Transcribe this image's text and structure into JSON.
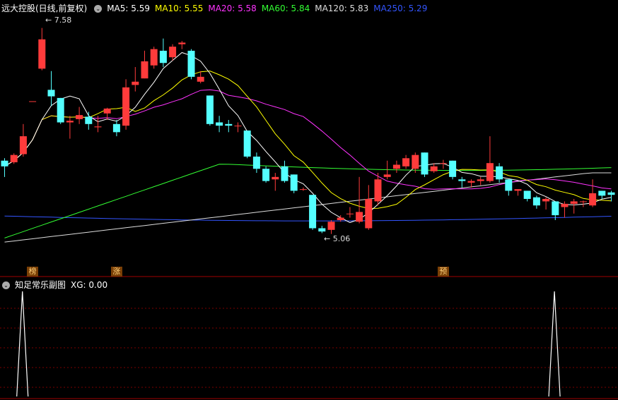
{
  "main_header": {
    "title": "远大控股(日线,前复权)",
    "ma": [
      {
        "label": "MA5: 5.59",
        "color": "#ffffff"
      },
      {
        "label": "MA10: 5.55",
        "color": "#ffff00"
      },
      {
        "label": "MA20: 5.58",
        "color": "#ff33ff"
      },
      {
        "label": "MA60: 5.84",
        "color": "#33ff33"
      },
      {
        "label": "MA120: 5.83",
        "color": "#dddddd"
      },
      {
        "label": "MA250: 5.29",
        "color": "#3355ff"
      }
    ]
  },
  "sub_header": {
    "title": "知足常乐副图",
    "xg_label": "XG: 0.00"
  },
  "annotations": {
    "high": "7.58",
    "low": "5.06"
  },
  "tags": [
    "榜",
    "涨",
    "预"
  ],
  "colors": {
    "up": "#ff3b3b",
    "down": "#54ffff",
    "grid": "#7a0000",
    "border": "#a00000"
  },
  "chart_data": {
    "type": "candlestick",
    "ylim": [
      4.7,
      7.75
    ],
    "candles": [
      [
        5.95,
        5.88,
        5.98,
        5.75
      ],
      [
        5.93,
        6.02,
        6.04,
        5.91
      ],
      [
        6.03,
        6.25,
        6.4,
        6.0
      ],
      [
        6.68,
        6.68,
        6.68,
        6.68
      ],
      [
        7.08,
        7.44,
        7.58,
        7.06
      ],
      [
        6.82,
        6.74,
        7.05,
        6.62
      ],
      [
        6.72,
        6.42,
        6.72,
        6.4
      ],
      [
        6.42,
        6.44,
        6.5,
        6.22
      ],
      [
        6.46,
        6.51,
        6.61,
        6.4
      ],
      [
        6.49,
        6.4,
        6.55,
        6.33
      ],
      [
        6.36,
        6.37,
        6.5,
        6.3
      ],
      [
        6.53,
        6.59,
        6.6,
        6.45
      ],
      [
        6.4,
        6.3,
        6.45,
        6.25
      ],
      [
        6.38,
        6.85,
        6.95,
        6.33
      ],
      [
        6.88,
        6.92,
        7.1,
        6.8
      ],
      [
        6.96,
        7.17,
        7.3,
        6.96
      ],
      [
        7.12,
        7.32,
        7.35,
        7.08
      ],
      [
        7.3,
        7.15,
        7.45,
        7.1
      ],
      [
        7.22,
        7.35,
        7.38,
        7.18
      ],
      [
        7.38,
        7.4,
        7.42,
        7.32
      ],
      [
        7.3,
        6.98,
        7.32,
        6.95
      ],
      [
        6.92,
        6.98,
        7.05,
        6.9
      ],
      [
        6.75,
        6.4,
        6.75,
        6.38
      ],
      [
        6.42,
        6.38,
        6.5,
        6.3
      ],
      [
        6.4,
        6.38,
        6.45,
        6.3
      ],
      [
        6.38,
        6.38,
        6.42,
        6.3
      ],
      [
        6.32,
        6.0,
        6.32,
        5.98
      ],
      [
        6.0,
        5.85,
        6.05,
        5.8
      ],
      [
        5.85,
        5.7,
        5.88,
        5.68
      ],
      [
        5.72,
        5.75,
        5.8,
        5.58
      ],
      [
        5.88,
        5.7,
        5.95,
        5.68
      ],
      [
        5.78,
        5.58,
        5.78,
        5.55
      ],
      [
        5.6,
        5.6,
        5.62,
        5.58
      ],
      [
        5.53,
        5.12,
        5.53,
        5.1
      ],
      [
        5.12,
        5.08,
        5.15,
        5.06
      ],
      [
        5.1,
        5.2,
        5.22,
        5.05
      ],
      [
        5.22,
        5.25,
        5.28,
        5.2
      ],
      [
        5.3,
        5.3,
        5.38,
        5.25
      ],
      [
        5.2,
        5.32,
        5.75,
        5.18
      ],
      [
        5.12,
        5.48,
        5.65,
        5.1
      ],
      [
        5.45,
        5.72,
        5.8,
        5.4
      ],
      [
        5.75,
        5.78,
        5.95,
        5.72
      ],
      [
        5.85,
        5.9,
        5.95,
        5.8
      ],
      [
        5.88,
        5.98,
        6.02,
        5.85
      ],
      [
        5.85,
        6.02,
        6.05,
        5.8
      ],
      [
        6.05,
        5.78,
        6.05,
        5.75
      ],
      [
        5.82,
        5.88,
        5.92,
        5.8
      ],
      [
        5.92,
        5.92,
        5.96,
        5.85
      ],
      [
        5.95,
        5.75,
        5.95,
        5.72
      ],
      [
        5.72,
        5.7,
        5.75,
        5.62
      ],
      [
        5.68,
        5.7,
        5.72,
        5.62
      ],
      [
        5.7,
        5.72,
        5.75,
        5.65
      ],
      [
        5.7,
        5.92,
        6.25,
        5.68
      ],
      [
        5.88,
        5.72,
        5.92,
        5.68
      ],
      [
        5.72,
        5.58,
        5.72,
        5.52
      ],
      [
        5.58,
        5.6,
        5.6,
        5.52
      ],
      [
        5.58,
        5.48,
        5.58,
        5.45
      ],
      [
        5.5,
        5.4,
        5.52,
        5.36
      ],
      [
        5.45,
        5.48,
        5.5,
        5.35
      ],
      [
        5.45,
        5.28,
        5.45,
        5.22
      ],
      [
        5.38,
        5.42,
        5.45,
        5.25
      ],
      [
        5.42,
        5.45,
        5.48,
        5.3
      ],
      [
        5.45,
        5.45,
        5.46,
        5.38
      ],
      [
        5.4,
        5.55,
        5.72,
        5.38
      ],
      [
        5.58,
        5.52,
        5.58,
        5.48
      ],
      [
        5.56,
        5.53,
        5.58,
        5.45
      ]
    ],
    "xg_spikes": [
      1,
      58
    ],
    "tag_positions": [
      3,
      12,
      47
    ]
  }
}
